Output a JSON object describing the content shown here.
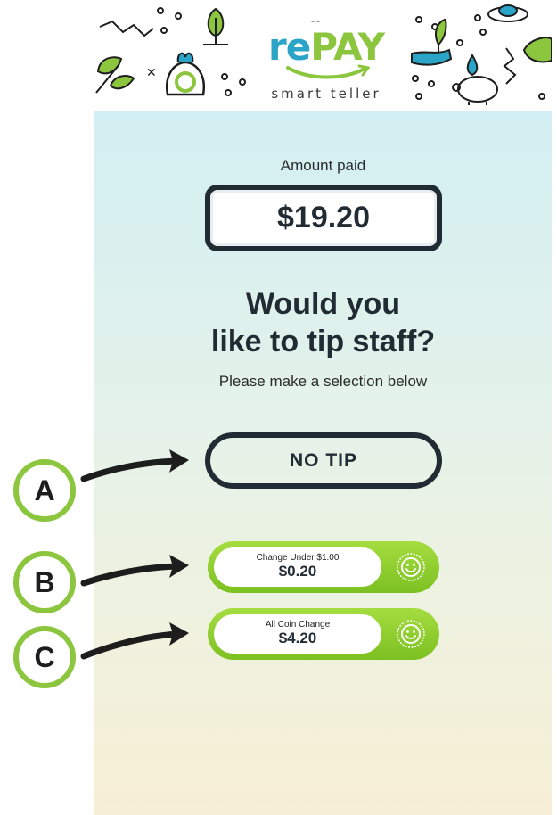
{
  "header": {
    "logo_dashes": "--",
    "logo_re": "re",
    "logo_pay": "PAY",
    "logo_subtitle": "smart teller",
    "colors": {
      "blue": "#2aa5c8",
      "green": "#8cc63f"
    },
    "decorations": [
      "zigzag-icon",
      "circles-icon",
      "tree-icon",
      "leaves-icon",
      "recycle-bag-icon",
      "hand-plant-icon",
      "water-drop-icon",
      "piggy-bank-icon",
      "leaf-icon"
    ]
  },
  "payment": {
    "amount_label": "Amount paid",
    "amount_value": "$19.20"
  },
  "prompt": {
    "line1": "Would you",
    "line2": "like to tip staff?",
    "instruction": "Please make a selection below"
  },
  "options": {
    "no_tip_label": "NO TIP",
    "tip_options": [
      {
        "title": "Change Under $1.00",
        "amount": "$0.20"
      },
      {
        "title": "All Coin Change",
        "amount": "$4.20"
      }
    ]
  },
  "annotations": [
    "A",
    "B",
    "C"
  ],
  "colors": {
    "dark": "#212b33",
    "accent_green": "#8cc63f",
    "button_green": "#7cc022"
  }
}
